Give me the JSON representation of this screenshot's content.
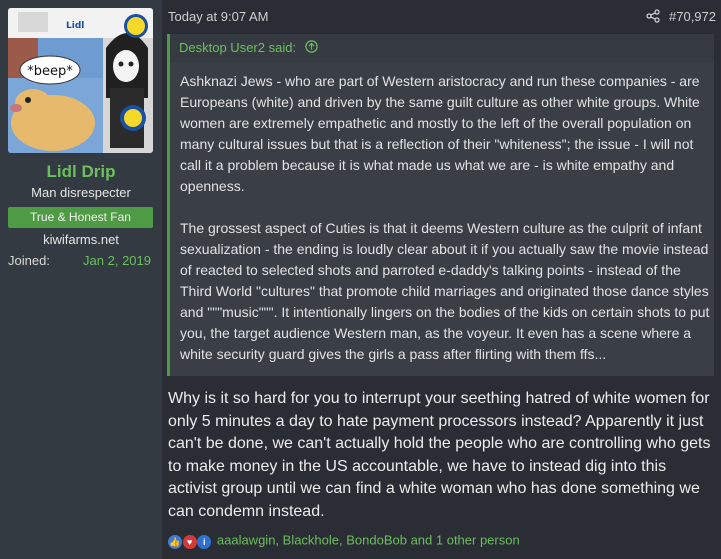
{
  "author": {
    "username": "Lidl Drip",
    "user_title": "Man disrespecter",
    "banner": "True & Honest Fan",
    "site": "kiwifarms.net",
    "joined_label": "Joined:",
    "joined_value": "Jan 2, 2019",
    "avatar_caption": "*beep*",
    "avatar_logo": "Lidl"
  },
  "post": {
    "date": "Today at 9:07 AM",
    "number": "#70,972",
    "quote": {
      "author": "Desktop User2 said:",
      "paragraphs": [
        "Ashknazi Jews - who are part of Western aristocracy and run these companies - are Europeans (white) and driven by the same guilt culture as other white groups. White women are extremely empathetic and mostly to the left of the overall population on many cultural issues but that is a reflection of their \"whiteness\"; the issue - I will not call it a problem because it is what made us what we are - is white empathy and openness.",
        "The grossest aspect of Cuties is that it deems Western culture as the culprit of infant sexualization - the ending is loudly clear about it if you actually saw the movie instead of reacted to selected shots and parroted e-daddy's talking points - instead of the Third World \"cultures\" that promote child marriages and originated those dance styles and \"\"\"music\"\"\". It intentionally lingers on the bodies of the kids on certain shots to put you, the target audience Western man, as the voyeur. It even has a scene where a white security guard gives the girls a pass after flirting with them ffs..."
      ]
    },
    "reply": "Why is it so hard for you to interrupt your seething hatred of white women for only 5 minutes a day to hate payment processors instead? Apparently it just can't be done, we can't actually hold the people who are controlling who gets to make money in the US accountable, we have to instead dig into this activist group until we can find a white woman who has done something we can condemn instead.",
    "reactions": {
      "icons": [
        "like-icon",
        "heart-icon",
        "info-icon"
      ],
      "users": "aaalawgin, Blackhole, BondoBob and 1 other person"
    }
  },
  "colors": {
    "background": "#2a2d34",
    "sidebar": "#343a41",
    "accent_green": "#6cbf5e",
    "banner_green": "#4f9a45",
    "quote_bg": "#3a3f46"
  }
}
